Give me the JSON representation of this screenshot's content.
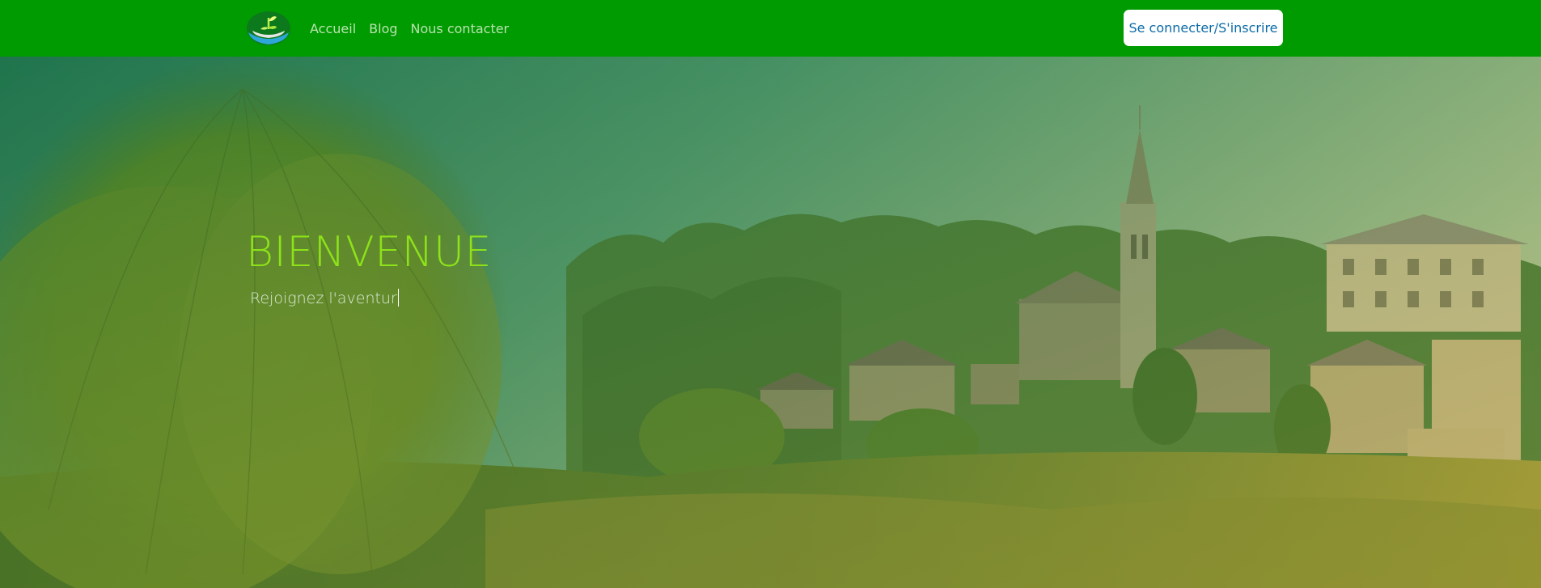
{
  "navbar": {
    "logo_icon": "plant-sprout-logo",
    "links": [
      {
        "label": "Accueil"
      },
      {
        "label": "Blog"
      },
      {
        "label": "Nous contacter"
      }
    ],
    "login_label": "Se connecter/S'inscrire"
  },
  "hero": {
    "title": "BIENVENUE",
    "subtitle": "Rejoignez l'aventur",
    "background": "village-landscape-with-church-and-willow-tree"
  },
  "colors": {
    "navbar_bg": "#009b00",
    "title": "#8de21a",
    "login_text": "#0b6ba6"
  }
}
